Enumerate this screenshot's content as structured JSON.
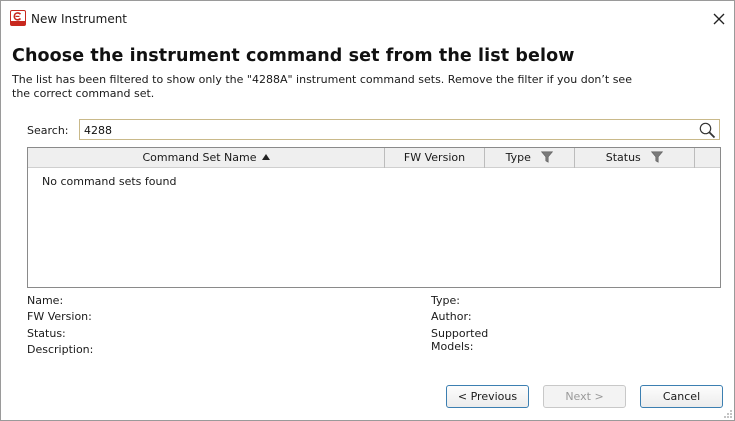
{
  "window": {
    "title": "New Instrument"
  },
  "header": {
    "heading": "Choose the instrument command set from the list below",
    "description_line1": "The list has been filtered to show only the \"4288A\" instrument command sets. Remove the filter if you don’t see",
    "description_line2": "the correct command set."
  },
  "search": {
    "label": "Search:",
    "value": "4288"
  },
  "table": {
    "columns": [
      {
        "label": "Command Set Name",
        "sort": "ascending"
      },
      {
        "label": "FW Version"
      },
      {
        "label": "Type",
        "filter": true
      },
      {
        "label": "Status",
        "filter": true
      }
    ],
    "empty_message": "No command sets found"
  },
  "details": {
    "name_label": "Name:",
    "fw_version_label": "FW Version:",
    "status_label": "Status:",
    "description_label": "Description:",
    "type_label": "Type:",
    "author_label": "Author:",
    "supported_models_label_line1": "Supported",
    "supported_models_label_line2": "Models:"
  },
  "buttons": {
    "previous": "< Previous",
    "next": "Next >",
    "cancel": "Cancel"
  },
  "colors": {
    "button_border": "#3c7fb1",
    "search_border": "#c9b98a",
    "app_icon_red": "#c8281e"
  },
  "icons": {
    "app": "app-logo-icon",
    "close": "close-icon",
    "search": "magnifier-icon",
    "sort": "sort-ascending-icon",
    "filter": "funnel-filter-icon"
  }
}
